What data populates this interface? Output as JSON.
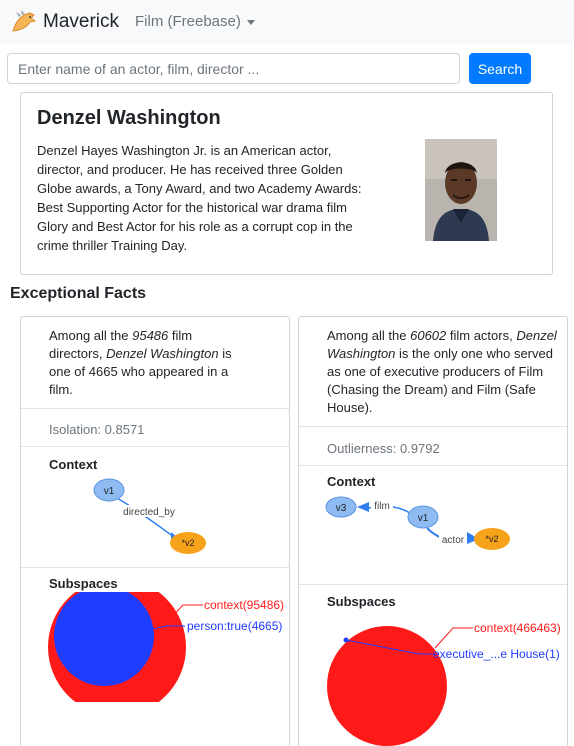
{
  "navbar": {
    "brand_name": "Maverick",
    "dataset_selector": "Film (Freebase)"
  },
  "search": {
    "placeholder": "Enter name of an actor, film, director ...",
    "button_label": "Search"
  },
  "entity": {
    "name": "Denzel Washington",
    "description": "Denzel Hayes Washington Jr. is an American actor, director, and producer. He has received three Golden Globe awards, a Tony Award, and two Academy Awards: Best Supporting Actor for the historical war drama film Glory and Best Actor for his role as a corrupt cop in the crime thriller Training Day."
  },
  "section_title": "Exceptional Facts",
  "facts": [
    {
      "text_prefix": "Among all the ",
      "total": "95486",
      "text_middle": " film directors, ",
      "entity": "Denzel Washington",
      "text_suffix": " is one of 4665 who appeared in a film.",
      "score": "Isolation: 0.8571",
      "context_label": "Context",
      "context_nodes": [
        "v1",
        "*v2"
      ],
      "context_edges": [
        "directed_by"
      ],
      "subspaces_label": "Subspaces",
      "subspace_labels": [
        "context(95486)",
        "person:true(4665)"
      ]
    },
    {
      "text_prefix": "Among all the ",
      "total": "60602",
      "text_middle": " film actors, ",
      "entity": "Denzel Washington",
      "text_suffix": " is the only one who served as one of executive producers of Film (Chasing the Dream) and Film (Safe House).",
      "score": "Outlierness: 0.9792",
      "context_label": "Context",
      "context_nodes": [
        "v3",
        "v1",
        "*v2"
      ],
      "context_edges": [
        "film",
        "actor"
      ],
      "subspaces_label": "Subspaces",
      "subspace_labels": [
        "context(466463)",
        "executive_...e House(1)"
      ]
    }
  ],
  "colors": {
    "primary": "#007bff",
    "context_circle": "#ff1a1a",
    "subspace_circle": "#1f3cff",
    "node_blue": "#8fbbf3",
    "node_orange": "#f7a21b",
    "edge_blue": "#2e7ef0"
  }
}
